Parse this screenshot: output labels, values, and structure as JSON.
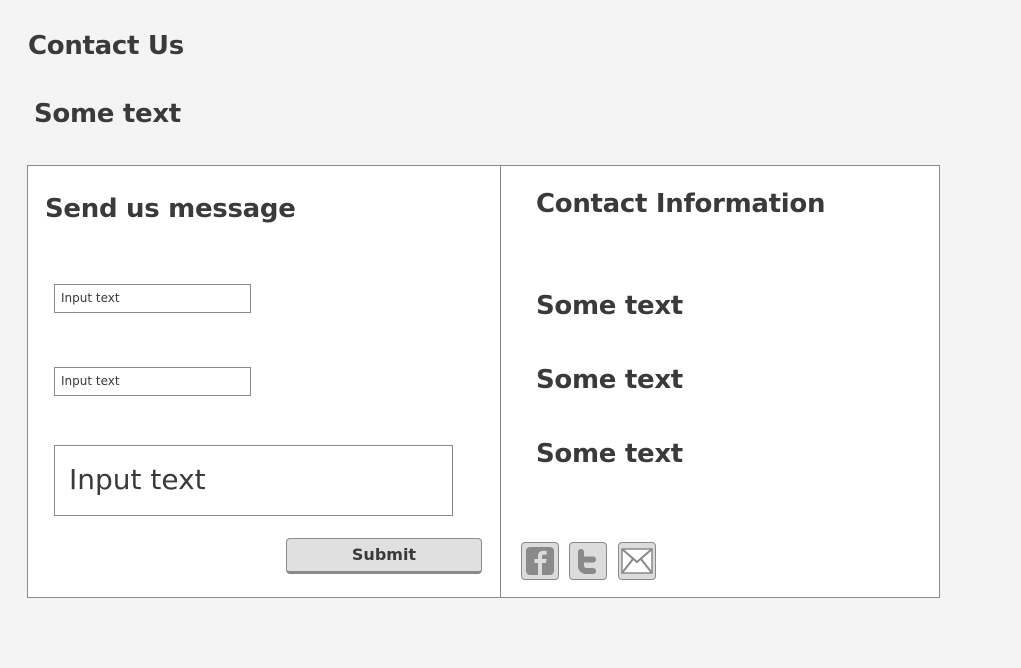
{
  "page": {
    "title": "Contact Us",
    "subtitle": "Some text"
  },
  "form": {
    "heading": "Send us message",
    "input_1_placeholder": "Input text",
    "input_2_placeholder": "Input text",
    "message_placeholder": "Input text",
    "submit_label": "Submit"
  },
  "contact": {
    "heading": "Contact Information",
    "lines": [
      "Some text",
      "Some text",
      "Some text"
    ],
    "social_icons": [
      "facebook-icon",
      "twitter-icon",
      "email-icon"
    ]
  },
  "colors": {
    "background": "#f4f4f4",
    "panel": "#ffffff",
    "border": "#8a8a8a",
    "text": "#3a3a3a",
    "icon_fill": "#8a8a8a"
  }
}
